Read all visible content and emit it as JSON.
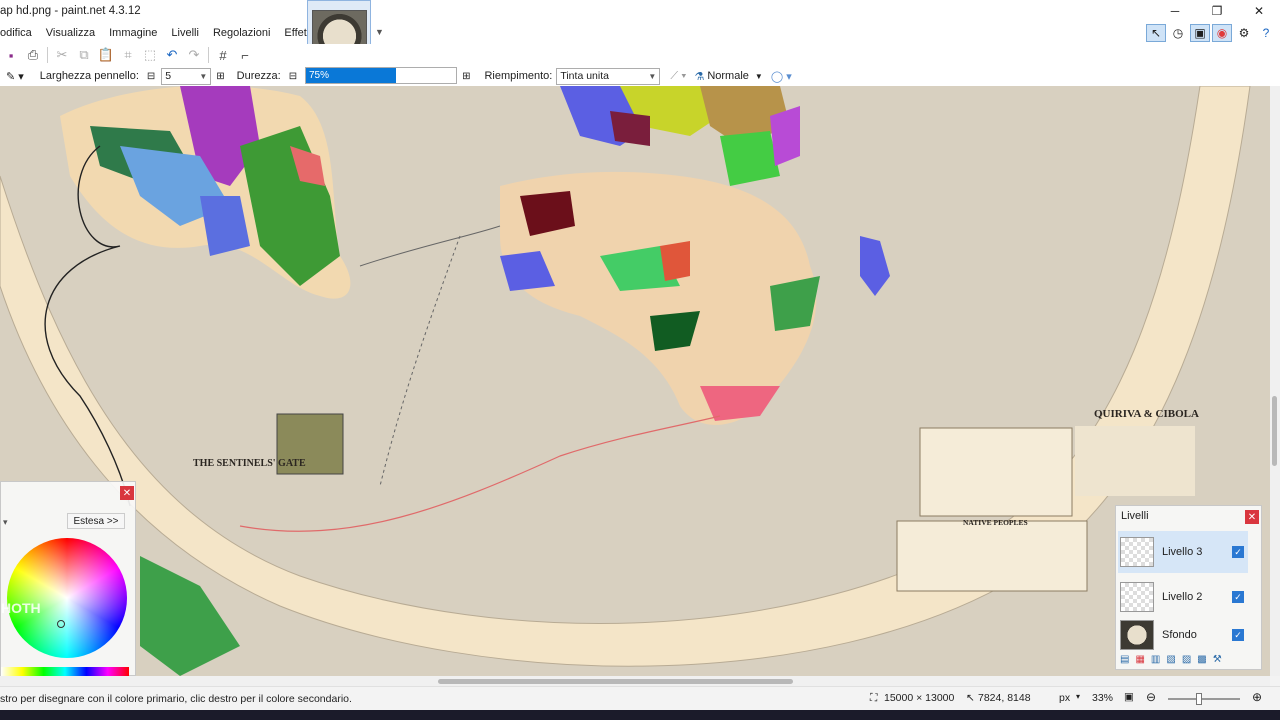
{
  "window": {
    "title": "ap hd.png - paint.net 4.3.12"
  },
  "menu": {
    "items": [
      "odifica",
      "Visualizza",
      "Immagine",
      "Livelli",
      "Regolazioni",
      "Effetti"
    ]
  },
  "toolbar": {
    "brush_width_label": "Larghezza pennello:",
    "brush_width_value": "5",
    "hardness_label": "Durezza:",
    "hardness_value": "75%",
    "hardness_fraction": 0.75,
    "fill_label": "Riempimento:",
    "fill_value": "Tinta unita",
    "blend_value": "Normale"
  },
  "map": {
    "labels": {
      "sentinels": "THE SENTINELS' GATE",
      "quiriva": "QUIRIVA & CIBOLA",
      "native": "NATIVE PEOPLES"
    }
  },
  "colors_panel": {
    "mode_label": "Estesa >>",
    "watermark": "HOTH"
  },
  "layers_panel": {
    "title": "Livelli",
    "layers": [
      {
        "name": "Livello 3",
        "visible": true,
        "selected": true
      },
      {
        "name": "Livello 2",
        "visible": true,
        "selected": false
      },
      {
        "name": "Sfondo",
        "visible": true,
        "selected": false
      }
    ]
  },
  "status": {
    "hint": "stro per disegnare con il colore primario, clic destro per il colore secondario.",
    "image_size": "15000 × 13000",
    "cursor_pos": "7824, 8148",
    "unit": "px",
    "zoom": "33%"
  },
  "colors": {
    "accent": "#0a78d7",
    "close": "#d9363e",
    "map_ocean": "#d8d0c0",
    "map_land": "#f2dcb8"
  }
}
